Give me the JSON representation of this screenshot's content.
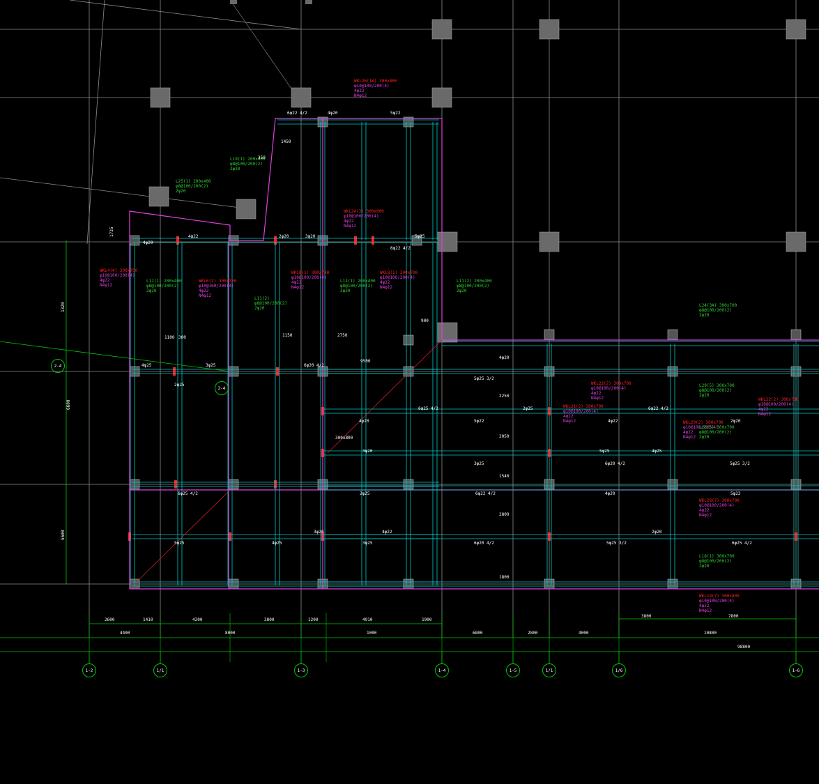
{
  "colors": {
    "background": "#000000",
    "grid": "#8c8c8c",
    "beam": "#00c8c8",
    "outline": "#e040e0",
    "dimension": "#00c800",
    "label_red": "#ff2020",
    "label_magenta": "#e040e0",
    "label_green": "#30d030",
    "label_cyan": "#00d0d0",
    "column": "#6a6a6a",
    "text_white": "#ffffff"
  },
  "axes": {
    "bottom": [
      "1-2",
      "1/1",
      "1-3",
      "1-4",
      "1-5",
      "1/1",
      "1/6",
      "1-6"
    ],
    "left": [
      "2-4",
      "2-4"
    ]
  },
  "dimensions": {
    "left_vertical": [
      "1320",
      "6600",
      "5600",
      "1735"
    ],
    "row1": [
      "2600",
      "1410",
      "4200",
      "3800",
      "1200",
      "4910",
      "1900",
      "3800",
      "7800"
    ],
    "row2": [
      "4400",
      "8000",
      "1000",
      "6800",
      "2800",
      "4000",
      "10800"
    ],
    "total": "98800"
  },
  "beam_labels": {
    "red": [
      "WKL4(4) 300x700",
      "WKL6(2) 300x700",
      "WKL8(1) 300x700",
      "WKL8(1) 300x700",
      "WKL26(1B) 300x800",
      "WKL24(3) 300x800",
      "WKL22(2) 300x700",
      "WKL21(2) 300x700",
      "WKL22(2) 300x700",
      "WKL20(2) 300x700",
      "WKL19(7) 300x800",
      "WKL28(7) 300x700"
    ],
    "green": [
      "L25(1) 200x400",
      "L19(1) 200x400",
      "L11(1) 200x400",
      "L11(1) 200x400",
      "L11(2) 200x400",
      "L24(3A) 300x700",
      "L29(5) 300x700",
      "L20(5) 300x700",
      "L18(1) 300x700",
      "L11(2)"
    ],
    "stirrup_main": "φ8@100/200(2)",
    "stirrup_alt": "φ10@100/200(4)",
    "reinf_a": "4φ22",
    "reinf_b": "2φ20",
    "reinf_c": "N4φ12",
    "reinf_d": "4φ25",
    "reinf_e": "3φ20"
  },
  "rebar_marks": [
    "6φ22 4/2",
    "4φ20",
    "5φ22",
    "4φ22",
    "2φ20",
    "3φ20",
    "5φ25",
    "4φ25",
    "3φ25",
    "6φ20 4/2",
    "5φ25 3/2",
    "6φ25 4/2",
    "2φ25"
  ],
  "small_dims": [
    "1100",
    "1150",
    "2750",
    "900",
    "1450",
    "350",
    "300",
    "4φ20",
    "2250",
    "2050",
    "1540",
    "2800",
    "1800",
    "9500",
    "300x800"
  ]
}
